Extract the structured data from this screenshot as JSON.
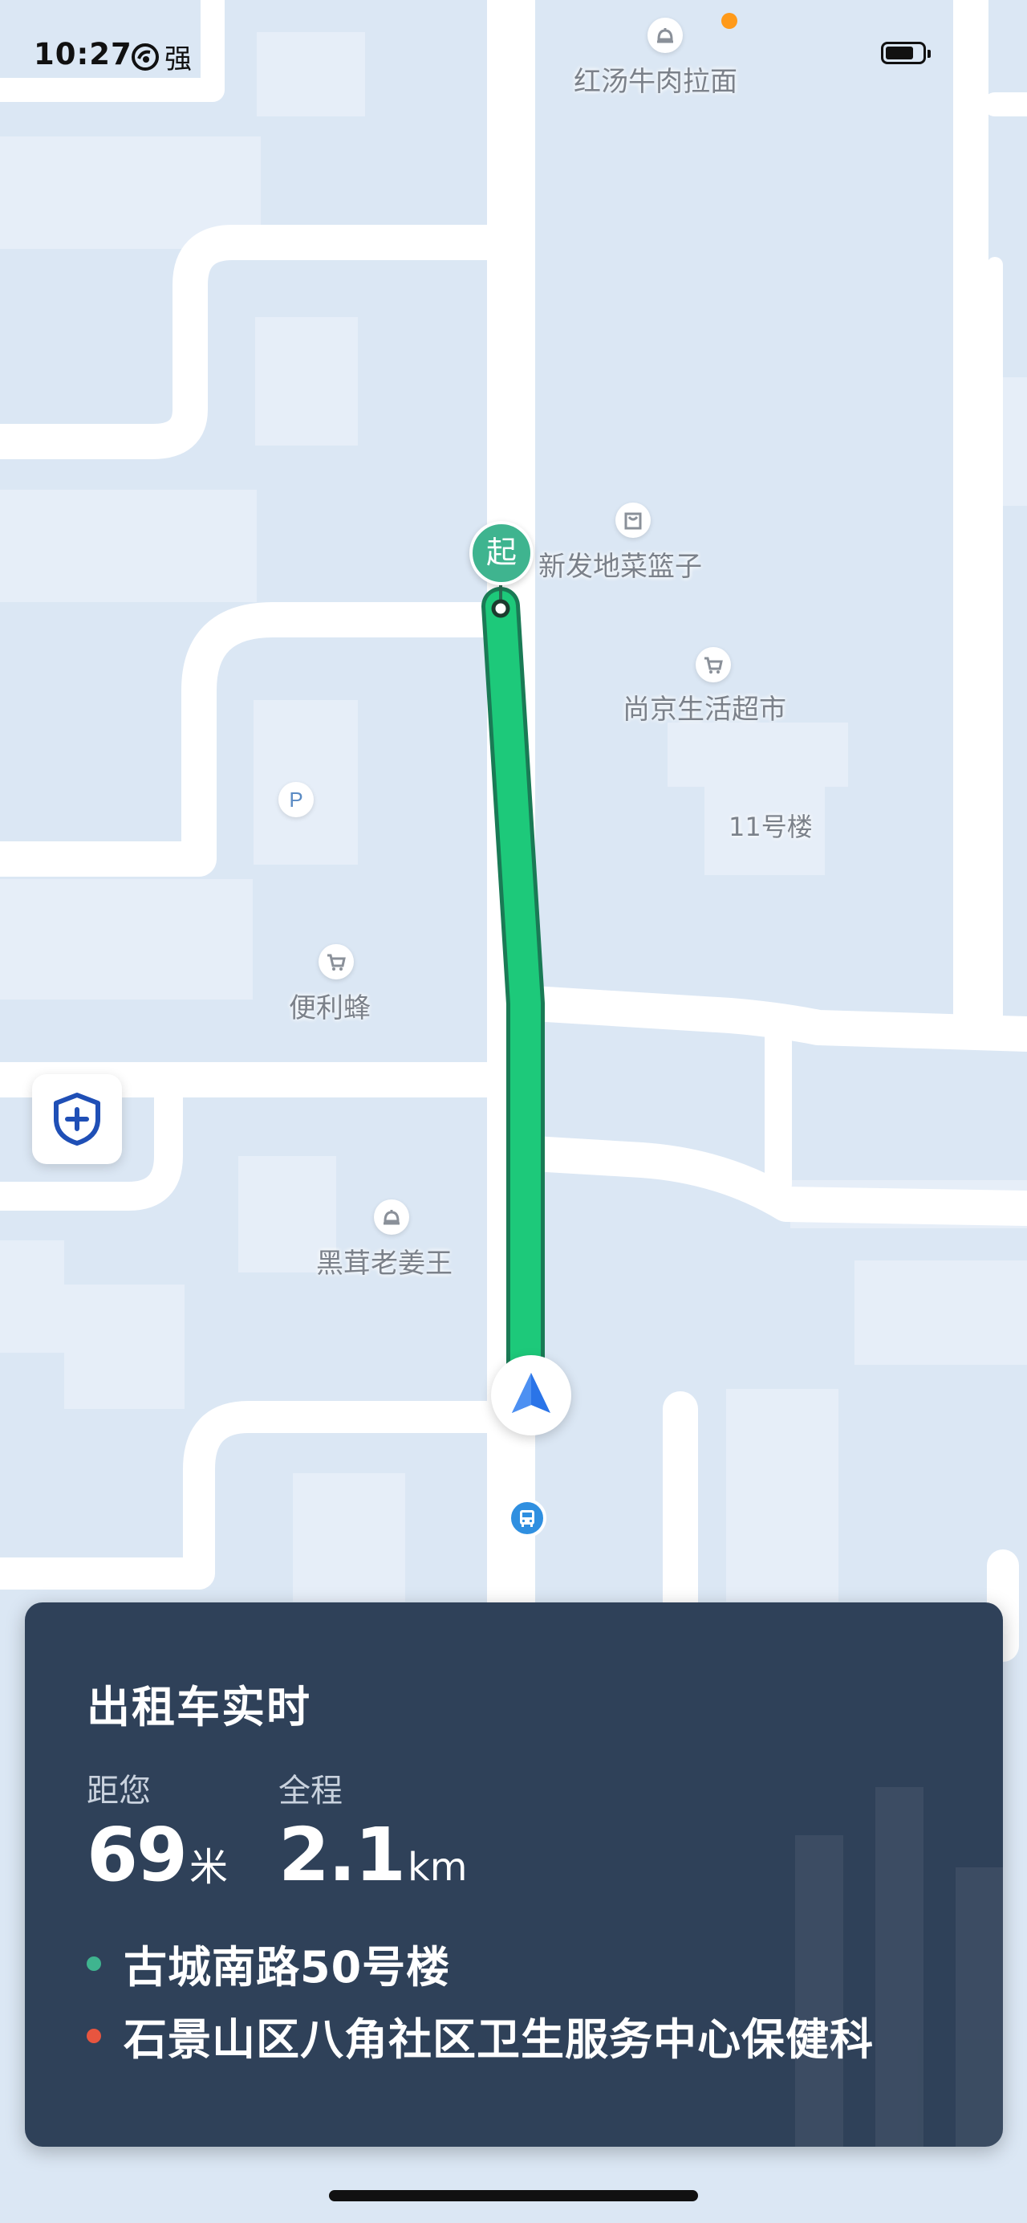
{
  "status_bar": {
    "time": "10:27",
    "carrier": "强",
    "colors": {
      "recording_dot": "#ff9a1a"
    }
  },
  "map": {
    "pois": [
      {
        "name": "红汤牛肉拉面",
        "icon": "restaurant-icon"
      },
      {
        "name": "新发地菜篮子",
        "icon": "shopping-bag-icon"
      },
      {
        "name": "尚京生活超市",
        "icon": "shopping-cart-icon"
      },
      {
        "name": "11号楼",
        "icon": ""
      },
      {
        "name": "P",
        "icon": "parking-icon"
      },
      {
        "name": "便利蜂",
        "icon": "shopping-cart-icon"
      },
      {
        "name": "黑茸老姜王",
        "icon": "restaurant-icon"
      }
    ],
    "start_marker": "起",
    "route_color": "#1dc97a",
    "icons": {
      "safety": "shield-plus-icon",
      "navigation": "navigation-arrow-icon",
      "bus_stop": "bus-icon"
    }
  },
  "panel": {
    "title": "出租车实时",
    "distance_label": "距您",
    "distance_value": "69",
    "distance_unit": "米",
    "total_label": "全程",
    "total_value": "2.1",
    "total_unit": "km",
    "origin": "古城南路50号楼",
    "destination": "石景山区八角社区卫生服务中心保健科",
    "colors": {
      "background": "#2f4159",
      "origin_dot": "#3fb48f",
      "destination_dot": "#e8553f"
    }
  }
}
